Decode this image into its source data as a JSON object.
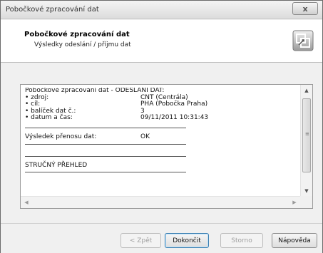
{
  "window": {
    "title": "Pobočkové zpracování dat",
    "close_glyph": "x"
  },
  "header": {
    "title": "Pobočkové zpracování dat",
    "subtitle": "Výsledky odeslání / příjmu dat",
    "icon": "transfer-arrows-icon"
  },
  "report": {
    "heading": "Pobočkové zpracování dat - ODESLÁNÍ DAT:",
    "rows": [
      {
        "label": "• zdroj:",
        "value": "CNT (Centrála)"
      },
      {
        "label": "• cíl:",
        "value": "PHA (Pobočka Praha)"
      },
      {
        "label": "• balíček dat č.:",
        "value": "3"
      },
      {
        "label": "• datum a čas:",
        "value": "09/11/2011 10:31:43"
      }
    ],
    "result_label": "Výsledek přenosu dat:",
    "result_value": "OK",
    "summary_heading": "STRUČNÝ PŘEHLED"
  },
  "buttons": {
    "back": "< Zpět",
    "back_mnemonic": "Z",
    "finish": "Dokončit",
    "cancel": "Storno",
    "help": "Nápověda"
  },
  "colors": {
    "accent_border": "#3c7fb1",
    "window_bg": "#f0f0f0"
  }
}
